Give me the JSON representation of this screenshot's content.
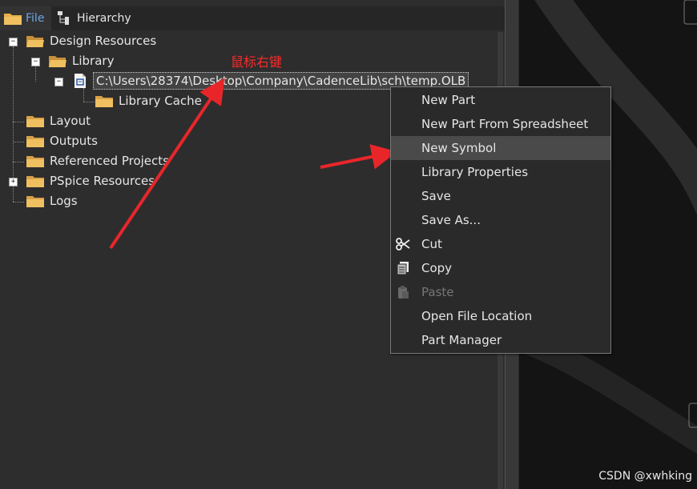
{
  "tabs": {
    "file": "File",
    "hierarchy": "Hierarchy"
  },
  "tree": {
    "design_resources": "Design Resources",
    "library": "Library",
    "olb_path": "C:\\Users\\28374\\Desktop\\Company\\CadenceLib\\sch\\temp.OLB",
    "library_cache": "Library Cache",
    "layout": "Layout",
    "outputs": "Outputs",
    "referenced_projects": "Referenced Projects",
    "pspice_resources": "PSpice Resources",
    "logs": "Logs"
  },
  "annotation": "鼠标右键",
  "context_menu": {
    "items": [
      {
        "label": "New Part"
      },
      {
        "label": "New Part From Spreadsheet"
      },
      {
        "label": "New Symbol",
        "highlighted": true
      },
      {
        "label": "Library Properties"
      },
      {
        "label": "Save"
      },
      {
        "label": "Save As..."
      },
      {
        "label": "Cut",
        "icon": "scissors-icon"
      },
      {
        "label": "Copy",
        "icon": "copy-icon"
      },
      {
        "label": "Paste",
        "icon": "paste-icon",
        "disabled": true
      },
      {
        "label": "Open File Location"
      },
      {
        "label": "Part Manager"
      }
    ]
  },
  "watermark": "CSDN @xwhking",
  "colors": {
    "annotation_red": "#e8262a",
    "tab_active_text": "#6aa7e6",
    "folder": "#e8b04a"
  }
}
